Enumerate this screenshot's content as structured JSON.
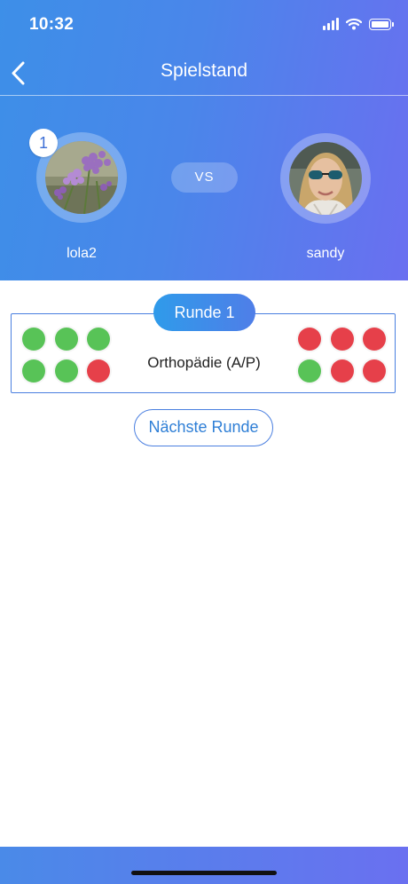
{
  "status_bar": {
    "time": "10:32"
  },
  "nav": {
    "title": "Spielstand"
  },
  "colors": {
    "accent": "#4a7fe0",
    "correct": "#58c357",
    "wrong": "#e6404a"
  },
  "players": {
    "left": {
      "name": "lola2",
      "rank": "1",
      "avatar": "flower-photo"
    },
    "right": {
      "name": "sandy",
      "avatar": "woman-sunglasses-photo"
    },
    "vs_label": "VS"
  },
  "rounds": [
    {
      "label": "Runde 1",
      "category": "Orthopädie (A/P)",
      "left_results": [
        "correct",
        "correct",
        "correct",
        "correct",
        "correct",
        "wrong"
      ],
      "right_results": [
        "wrong",
        "wrong",
        "wrong",
        "correct",
        "wrong",
        "wrong"
      ]
    }
  ],
  "actions": {
    "next_round": "Nächste Runde"
  }
}
